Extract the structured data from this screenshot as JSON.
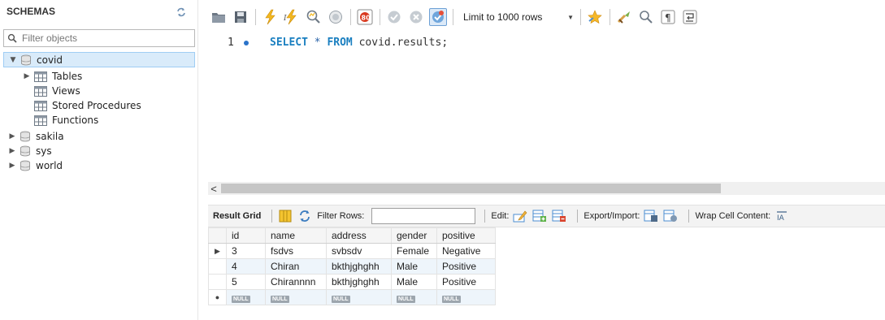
{
  "navigator": {
    "title": "SCHEMAS",
    "filter_placeholder": "Filter objects",
    "schemas": [
      {
        "name": "covid",
        "expanded": true,
        "children": [
          "Tables",
          "Views",
          "Stored Procedures",
          "Functions"
        ]
      },
      {
        "name": "sakila",
        "expanded": false
      },
      {
        "name": "sys",
        "expanded": false
      },
      {
        "name": "world",
        "expanded": false
      }
    ]
  },
  "toolbar": {
    "limit_label": "Limit to 1000 rows",
    "icons": [
      "open-file-icon",
      "save-icon",
      "execute-icon",
      "execute-selection-icon",
      "explain-icon",
      "stop-icon",
      "toggle-continue-on-error-icon",
      "commit-icon",
      "rollback-icon",
      "autocommit-icon",
      "beautify-icon",
      "find-icon",
      "invisible-chars-icon",
      "wrap-lines-icon"
    ]
  },
  "editor": {
    "line_number": "1",
    "sql": {
      "kw1": "SELECT",
      "star": "*",
      "kw2": "FROM",
      "target": "covid.results;"
    }
  },
  "result_toolbar": {
    "result_grid_label": "Result Grid",
    "filter_rows_label": "Filter Rows:",
    "filter_rows_value": "",
    "edit_label": "Edit:",
    "export_label": "Export/Import:",
    "wrap_label": "Wrap Cell Content:"
  },
  "grid": {
    "columns": [
      "id",
      "name",
      "address",
      "gender",
      "positive"
    ],
    "rows": [
      [
        "3",
        "fsdvs",
        "svbsdv",
        "Female",
        "Negative"
      ],
      [
        "4",
        "Chiran",
        "bkthjghghh",
        "Male",
        "Positive"
      ],
      [
        "5",
        "Chirannnn",
        "bkthjghghh",
        "Male",
        "Positive"
      ]
    ],
    "null_text": "NULL"
  },
  "colors": {
    "keyword": "#1a7fc0",
    "selection": "#d9ebfa",
    "row_alt": "#eef5fb"
  }
}
